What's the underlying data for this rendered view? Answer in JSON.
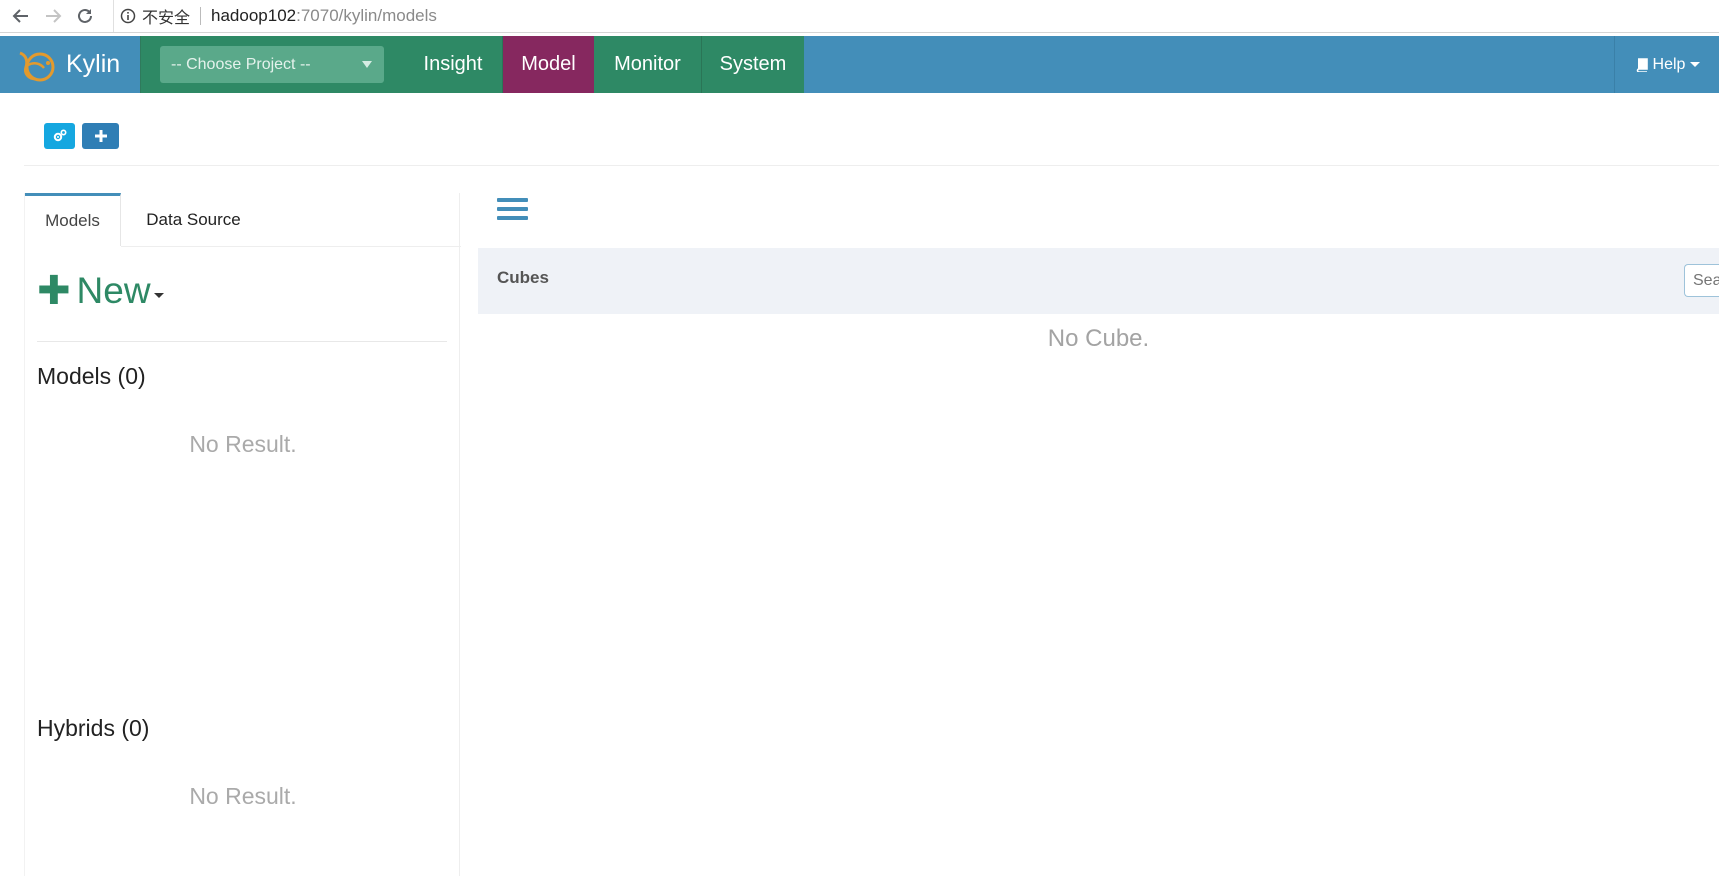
{
  "browser": {
    "security_label": "不安全",
    "url_host": "hadoop102",
    "url_path": ":7070/kylin/models"
  },
  "header": {
    "brand": "Kylin",
    "project_placeholder": "-- Choose Project --",
    "nav": [
      "Insight",
      "Model",
      "Monitor",
      "System"
    ],
    "active_nav": "Model",
    "help_label": "Help"
  },
  "colors": {
    "header_blue": "#438eb9",
    "nav_green": "#2e8965",
    "active_purple": "#86285f"
  },
  "toolbar": {
    "buttons": [
      "settings-icon",
      "plus-icon"
    ]
  },
  "left": {
    "tabs": [
      "Models",
      "Data Source"
    ],
    "active_tab": "Models",
    "new_label": "New",
    "models_title": "Models (0)",
    "models_empty": "No Result.",
    "hybrids_title": "Hybrids (0)",
    "hybrids_empty": "No Result."
  },
  "main": {
    "cubes_title": "Cubes",
    "search_placeholder": "Search",
    "empty_text": "No Cube."
  }
}
